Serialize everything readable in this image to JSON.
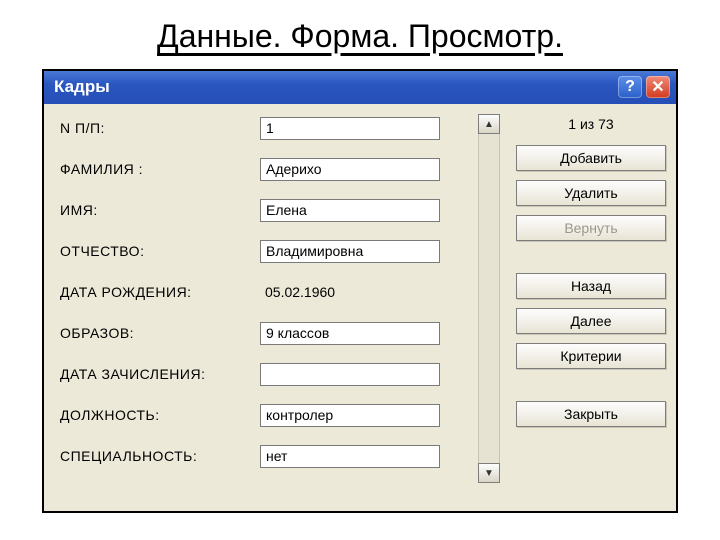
{
  "page_title": "Данные. Форма. Просмотр.",
  "window": {
    "title": "Кадры",
    "counter": "1 из 73"
  },
  "fields": {
    "npp": {
      "label": "N П/П:",
      "value": "1",
      "type": "input"
    },
    "familiya": {
      "label": "ФАМИЛИЯ   :",
      "value": "Адерихо",
      "type": "input"
    },
    "imya": {
      "label": "ИМЯ:",
      "value": "Елена",
      "type": "input"
    },
    "otchestvo": {
      "label": "ОТЧЕСТВО:",
      "value": "Владимировна",
      "type": "input"
    },
    "dob": {
      "label": "ДАТА РОЖДЕНИЯ:",
      "value": "05.02.1960",
      "type": "plain"
    },
    "obrazov": {
      "label": "ОБРАЗОВ:",
      "value": "9 классов",
      "type": "input"
    },
    "datezach": {
      "label": "ДАТА ЗАЧИСЛЕНИЯ:",
      "value": "",
      "type": "input"
    },
    "dolzh": {
      "label": "ДОЛЖНОСТЬ:",
      "value": "контролер",
      "type": "input"
    },
    "spec": {
      "label": "СПЕЦИАЛЬНОСТЬ:",
      "value": "нет",
      "type": "input"
    }
  },
  "buttons": {
    "add": "Добавить",
    "delete": "Удалить",
    "restore": "Вернуть",
    "back": "Назад",
    "next": "Далее",
    "criteria": "Критерии",
    "close": "Закрыть"
  }
}
